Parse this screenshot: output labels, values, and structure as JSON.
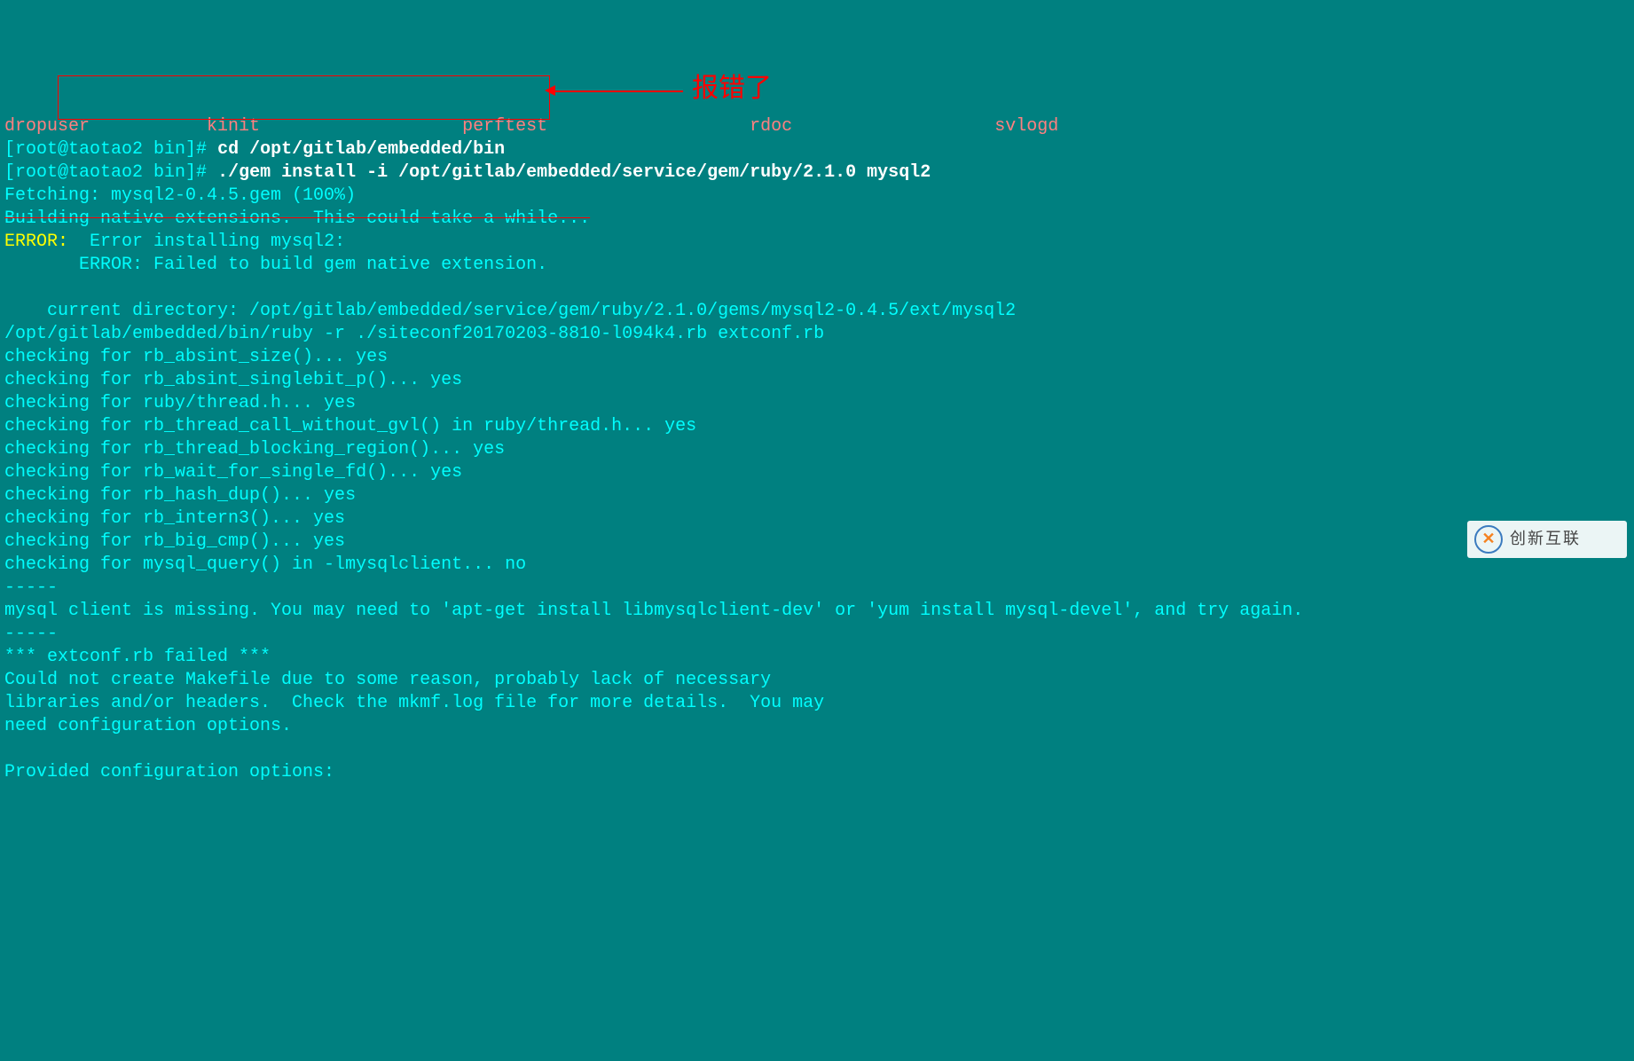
{
  "topbar": {
    "t1": "dropuser",
    "t2": "kinit",
    "t3": "perftest",
    "t4": "rdoc",
    "t5": "svlogd"
  },
  "prompt": {
    "user_host": "[root@taotao2 bin]#"
  },
  "cmd": {
    "line1": "cd /opt/gitlab/embedded/bin",
    "line2": "./gem install -i /opt/gitlab/embedded/service/gem/ruby/2.1.0 mysql2"
  },
  "out": {
    "fetching": "Fetching: mysql2-0.4.5.gem (100%)",
    "building": "Building native extensions.  This could take a while...",
    "error_label": "ERROR:",
    "error_msg1": "  Error installing mysql2:",
    "error_msg2": "       ERROR: Failed to build gem native extension.",
    "blank": " ",
    "dir": "    current directory: /opt/gitlab/embedded/service/gem/ruby/2.1.0/gems/mysql2-0.4.5/ext/mysql2",
    "ruby": "/opt/gitlab/embedded/bin/ruby -r ./siteconf20170203-8810-l094k4.rb extconf.rb",
    "c1": "checking for rb_absint_size()... yes",
    "c2": "checking for rb_absint_singlebit_p()... yes",
    "c3": "checking for ruby/thread.h... yes",
    "c4": "checking for rb_thread_call_without_gvl() in ruby/thread.h... yes",
    "c5": "checking for rb_thread_blocking_region()... yes",
    "c6": "checking for rb_wait_for_single_fd()... yes",
    "c7": "checking for rb_hash_dup()... yes",
    "c8": "checking for rb_intern3()... yes",
    "c9": "checking for rb_big_cmp()... yes",
    "c10": "checking for mysql_query() in -lmysqlclient... no",
    "dash": "-----",
    "miss": "mysql client is missing. You may need to 'apt-get install libmysqlclient-dev' or 'yum install mysql-devel', and try again.",
    "extfail": "*** extconf.rb failed ***",
    "mk1": "Could not create Makefile due to some reason, probably lack of necessary",
    "mk2": "libraries and/or headers.  Check the mkmf.log file for more details.  You may",
    "mk3": "need configuration options.",
    "prov": "Provided configuration options:"
  },
  "annotation": {
    "cn": "报错了"
  },
  "watermark": {
    "text": "创新互联"
  }
}
